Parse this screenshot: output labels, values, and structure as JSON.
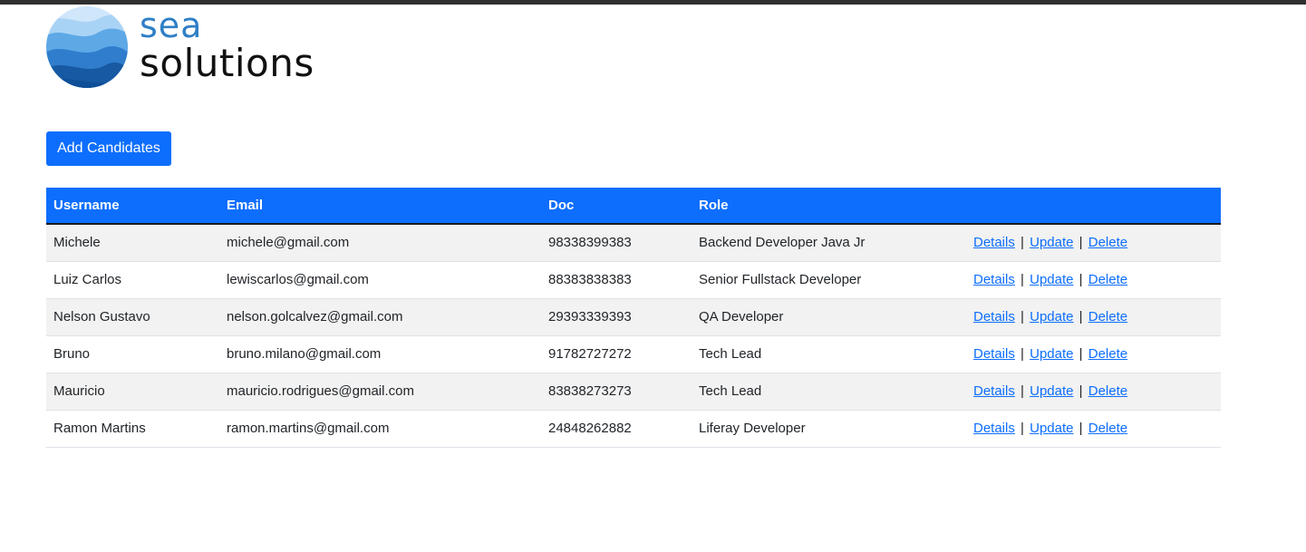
{
  "brand": {
    "line1": "sea",
    "line2": "solutions",
    "colors": {
      "accent": "#2e7fc6",
      "wave_light": "#a9d3f5",
      "wave_mid": "#5ea8e6",
      "wave_dark": "#1f67b1",
      "wave_deep": "#0e4f97"
    }
  },
  "toolbar": {
    "add_label": "Add Candidates"
  },
  "table": {
    "headers": {
      "username": "Username",
      "email": "Email",
      "doc": "Doc",
      "role": "Role",
      "actions": ""
    },
    "actions": {
      "details": "Details",
      "update": "Update",
      "delete": "Delete",
      "separator": "|"
    },
    "rows": [
      {
        "username": "Michele",
        "email": "michele@gmail.com",
        "doc": "98338399383",
        "role": "Backend Developer Java Jr"
      },
      {
        "username": "Luiz Carlos",
        "email": "lewiscarlos@gmail.com",
        "doc": "88383838383",
        "role": "Senior Fullstack Developer"
      },
      {
        "username": "Nelson Gustavo",
        "email": "nelson.golcalvez@gmail.com",
        "doc": "29393339393",
        "role": "QA Developer"
      },
      {
        "username": "Bruno",
        "email": "bruno.milano@gmail.com",
        "doc": "91782727272",
        "role": "Tech Lead"
      },
      {
        "username": "Mauricio",
        "email": "mauricio.rodrigues@gmail.com",
        "doc": "83838273273",
        "role": "Tech Lead"
      },
      {
        "username": "Ramon Martins",
        "email": "ramon.martins@gmail.com",
        "doc": "24848262882",
        "role": "Liferay Developer"
      }
    ]
  },
  "theme": {
    "primary": "#0d6efd",
    "stripe": "#f2f2f2",
    "top_bar": "#2f2f2f"
  }
}
